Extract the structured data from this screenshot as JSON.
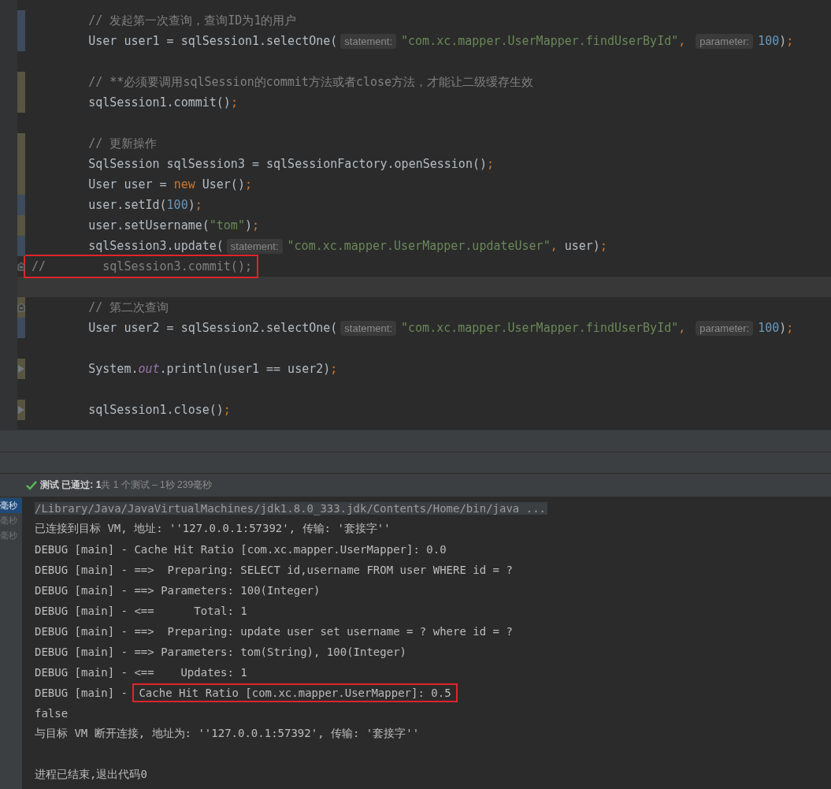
{
  "editor": {
    "lines": [
      {
        "modified": true,
        "added": false,
        "boxed": false,
        "current": false,
        "parts": [
          {
            "kind": "code",
            "tokens": [
              {
                "text": "        // 发起第一次查询，查询ID为1的用户",
                "kind": "comment"
              }
            ]
          }
        ]
      },
      {
        "modified": true,
        "added": false,
        "boxed": false,
        "current": false,
        "parts": [
          {
            "kind": "code",
            "tokens": [
              {
                "text": "        User user1 = sqlSession1.selectOne(",
                "kind": "plain"
              }
            ]
          },
          {
            "kind": "hint",
            "text": "statement:"
          },
          {
            "kind": "code",
            "tokens": [
              {
                "text": "\"com.xc.mapper.UserMapper.findUserById\"",
                "kind": "string"
              },
              {
                "text": ", ",
                "kind": "punct"
              }
            ]
          },
          {
            "kind": "hint",
            "text": "parameter:"
          },
          {
            "kind": "code",
            "tokens": [
              {
                "text": "100",
                "kind": "number"
              },
              {
                "text": ")",
                "kind": "plain"
              },
              {
                "text": ";",
                "kind": "punct"
              }
            ]
          }
        ]
      },
      {
        "modified": false,
        "added": false,
        "boxed": false,
        "current": false
      },
      {
        "modified": false,
        "added": true,
        "boxed": false,
        "current": false,
        "parts": [
          {
            "kind": "code",
            "tokens": [
              {
                "text": "        // **必须要调用sqlSession的commit方法或者close方法，才能让二级缓存生效",
                "kind": "comment"
              }
            ]
          }
        ]
      },
      {
        "modified": false,
        "added": true,
        "boxed": false,
        "current": false,
        "parts": [
          {
            "kind": "code",
            "tokens": [
              {
                "text": "        sqlSession1.commit()",
                "kind": "plain"
              },
              {
                "text": ";",
                "kind": "punct"
              }
            ]
          }
        ]
      },
      {
        "modified": false,
        "added": false,
        "boxed": false,
        "current": false
      },
      {
        "modified": false,
        "added": true,
        "boxed": false,
        "current": false,
        "parts": [
          {
            "kind": "code",
            "tokens": [
              {
                "text": "        // 更新操作",
                "kind": "comment"
              }
            ]
          }
        ]
      },
      {
        "modified": false,
        "added": true,
        "boxed": false,
        "current": false,
        "parts": [
          {
            "kind": "code",
            "tokens": [
              {
                "text": "        SqlSession sqlSession3 = sqlSessionFactory.openSession()",
                "kind": "plain"
              },
              {
                "text": ";",
                "kind": "punct"
              }
            ]
          }
        ]
      },
      {
        "modified": false,
        "added": true,
        "boxed": false,
        "current": false,
        "parts": [
          {
            "kind": "code",
            "tokens": [
              {
                "text": "        User user = ",
                "kind": "plain"
              },
              {
                "text": "new",
                "kind": "keyword"
              },
              {
                "text": " User()",
                "kind": "plain"
              },
              {
                "text": ";",
                "kind": "punct"
              }
            ]
          }
        ]
      },
      {
        "modified": true,
        "added": false,
        "boxed": false,
        "current": false,
        "parts": [
          {
            "kind": "code",
            "tokens": [
              {
                "text": "        user.setId(",
                "kind": "plain"
              },
              {
                "text": "100",
                "kind": "number"
              },
              {
                "text": ")",
                "kind": "plain"
              },
              {
                "text": ";",
                "kind": "punct"
              }
            ]
          }
        ]
      },
      {
        "modified": false,
        "added": true,
        "boxed": false,
        "current": false,
        "parts": [
          {
            "kind": "code",
            "tokens": [
              {
                "text": "        user.setUsername(",
                "kind": "plain"
              },
              {
                "text": "\"tom\"",
                "kind": "string"
              },
              {
                "text": ")",
                "kind": "plain"
              },
              {
                "text": ";",
                "kind": "punct"
              }
            ]
          }
        ]
      },
      {
        "modified": true,
        "added": false,
        "boxed": false,
        "current": false,
        "parts": [
          {
            "kind": "code",
            "tokens": [
              {
                "text": "        sqlSession3.update(",
                "kind": "plain"
              }
            ]
          },
          {
            "kind": "hint",
            "text": "statement:"
          },
          {
            "kind": "code",
            "tokens": [
              {
                "text": "\"com.xc.mapper.UserMapper.updateUser\"",
                "kind": "string"
              },
              {
                "text": ", ",
                "kind": "punct"
              },
              {
                "text": "user)",
                "kind": "plain"
              },
              {
                "text": ";",
                "kind": "punct"
              }
            ]
          }
        ]
      },
      {
        "kind": "fold",
        "modified": false,
        "added": false,
        "boxed": true,
        "current": false,
        "parts": [
          {
            "kind": "code",
            "tokens": [
              {
                "text": "//        sqlSession3.commit();",
                "kind": "comment"
              }
            ]
          }
        ]
      },
      {
        "modified": false,
        "added": false,
        "boxed": false,
        "current": true
      },
      {
        "kind": "fold",
        "modified": false,
        "added": true,
        "boxed": false,
        "current": false,
        "parts": [
          {
            "kind": "code",
            "tokens": [
              {
                "text": "        // 第二次查询",
                "kind": "comment"
              }
            ]
          }
        ]
      },
      {
        "modified": true,
        "added": false,
        "boxed": false,
        "current": false,
        "parts": [
          {
            "kind": "code",
            "tokens": [
              {
                "text": "        User user2 = sqlSession2.selectOne(",
                "kind": "plain"
              }
            ]
          },
          {
            "kind": "hint",
            "text": "statement:"
          },
          {
            "kind": "code",
            "tokens": [
              {
                "text": "\"com.xc.mapper.UserMapper.findUserById\"",
                "kind": "string"
              },
              {
                "text": ", ",
                "kind": "punct"
              }
            ]
          },
          {
            "kind": "hint",
            "text": "parameter:"
          },
          {
            "kind": "code",
            "tokens": [
              {
                "text": "100",
                "kind": "number"
              },
              {
                "text": ")",
                "kind": "plain"
              },
              {
                "text": ";",
                "kind": "punct"
              }
            ]
          }
        ]
      },
      {
        "modified": false,
        "added": false,
        "boxed": false,
        "current": false
      },
      {
        "kind": "run",
        "modified": false,
        "added": true,
        "boxed": false,
        "current": false,
        "parts": [
          {
            "kind": "code",
            "tokens": [
              {
                "text": "        System.",
                "kind": "plain"
              },
              {
                "text": "out",
                "kind": "field"
              },
              {
                "text": ".println(user1 == user2)",
                "kind": "plain"
              },
              {
                "text": ";",
                "kind": "punct"
              }
            ]
          }
        ]
      },
      {
        "modified": false,
        "added": false,
        "boxed": false,
        "current": false
      },
      {
        "kind": "run",
        "modified": false,
        "added": true,
        "boxed": false,
        "current": false,
        "parts": [
          {
            "kind": "code",
            "tokens": [
              {
                "text": "        sqlSession1.close()",
                "kind": "plain"
              },
              {
                "text": ";",
                "kind": "punct"
              }
            ]
          }
        ]
      }
    ]
  },
  "test_status": {
    "passed": "测试 已通过: 1",
    "summary": "共 1 个测试 – 1秒 239毫秒"
  },
  "test_tree": [
    {
      "label": "毫秒",
      "selected": true
    },
    {
      "label": "毫秒",
      "selected": false
    },
    {
      "label": "毫秒",
      "selected": false
    }
  ],
  "console": {
    "lines": [
      {
        "selected": true,
        "segments": [
          {
            "text": "/Library/Java/JavaVirtualMachines/jdk1.8.0_333.jdk/Contents/Home/bin/java ...",
            "boxed": false
          }
        ]
      },
      {
        "selected": false,
        "segments": [
          {
            "text": "已连接到目标 VM, 地址: ''127.0.0.1:57392', 传输: '套接字''",
            "boxed": false
          }
        ]
      },
      {
        "selected": false,
        "segments": [
          {
            "text": "DEBUG [main] - Cache Hit Ratio [com.xc.mapper.UserMapper]: 0.0",
            "boxed": false
          }
        ]
      },
      {
        "selected": false,
        "segments": [
          {
            "text": "DEBUG [main] - ==>  Preparing: SELECT id,username FROM user WHERE id = ?",
            "boxed": false
          }
        ]
      },
      {
        "selected": false,
        "segments": [
          {
            "text": "DEBUG [main] - ==> Parameters: 100(Integer)",
            "boxed": false
          }
        ]
      },
      {
        "selected": false,
        "segments": [
          {
            "text": "DEBUG [main] - <==      Total: 1",
            "boxed": false
          }
        ]
      },
      {
        "selected": false,
        "segments": [
          {
            "text": "DEBUG [main] - ==>  Preparing: update user set username = ? where id = ?",
            "boxed": false
          }
        ]
      },
      {
        "selected": false,
        "segments": [
          {
            "text": "DEBUG [main] - ==> Parameters: tom(String), 100(Integer)",
            "boxed": false
          }
        ]
      },
      {
        "selected": false,
        "segments": [
          {
            "text": "DEBUG [main] - <==    Updates: 1",
            "boxed": false
          }
        ]
      },
      {
        "selected": false,
        "segments": [
          {
            "text": "DEBUG [main] - ",
            "boxed": false
          },
          {
            "text": "Cache Hit Ratio [com.xc.mapper.UserMapper]: 0.5",
            "boxed": true
          }
        ]
      },
      {
        "selected": false,
        "segments": [
          {
            "text": "false",
            "boxed": false
          }
        ]
      },
      {
        "selected": false,
        "segments": [
          {
            "text": "与目标 VM 断开连接, 地址为: ''127.0.0.1:57392', 传输: '套接字''",
            "boxed": false
          }
        ]
      },
      {
        "selected": false
      },
      {
        "selected": false,
        "segments": [
          {
            "text": "进程已结束,退出代码0",
            "boxed": false
          }
        ]
      }
    ]
  }
}
